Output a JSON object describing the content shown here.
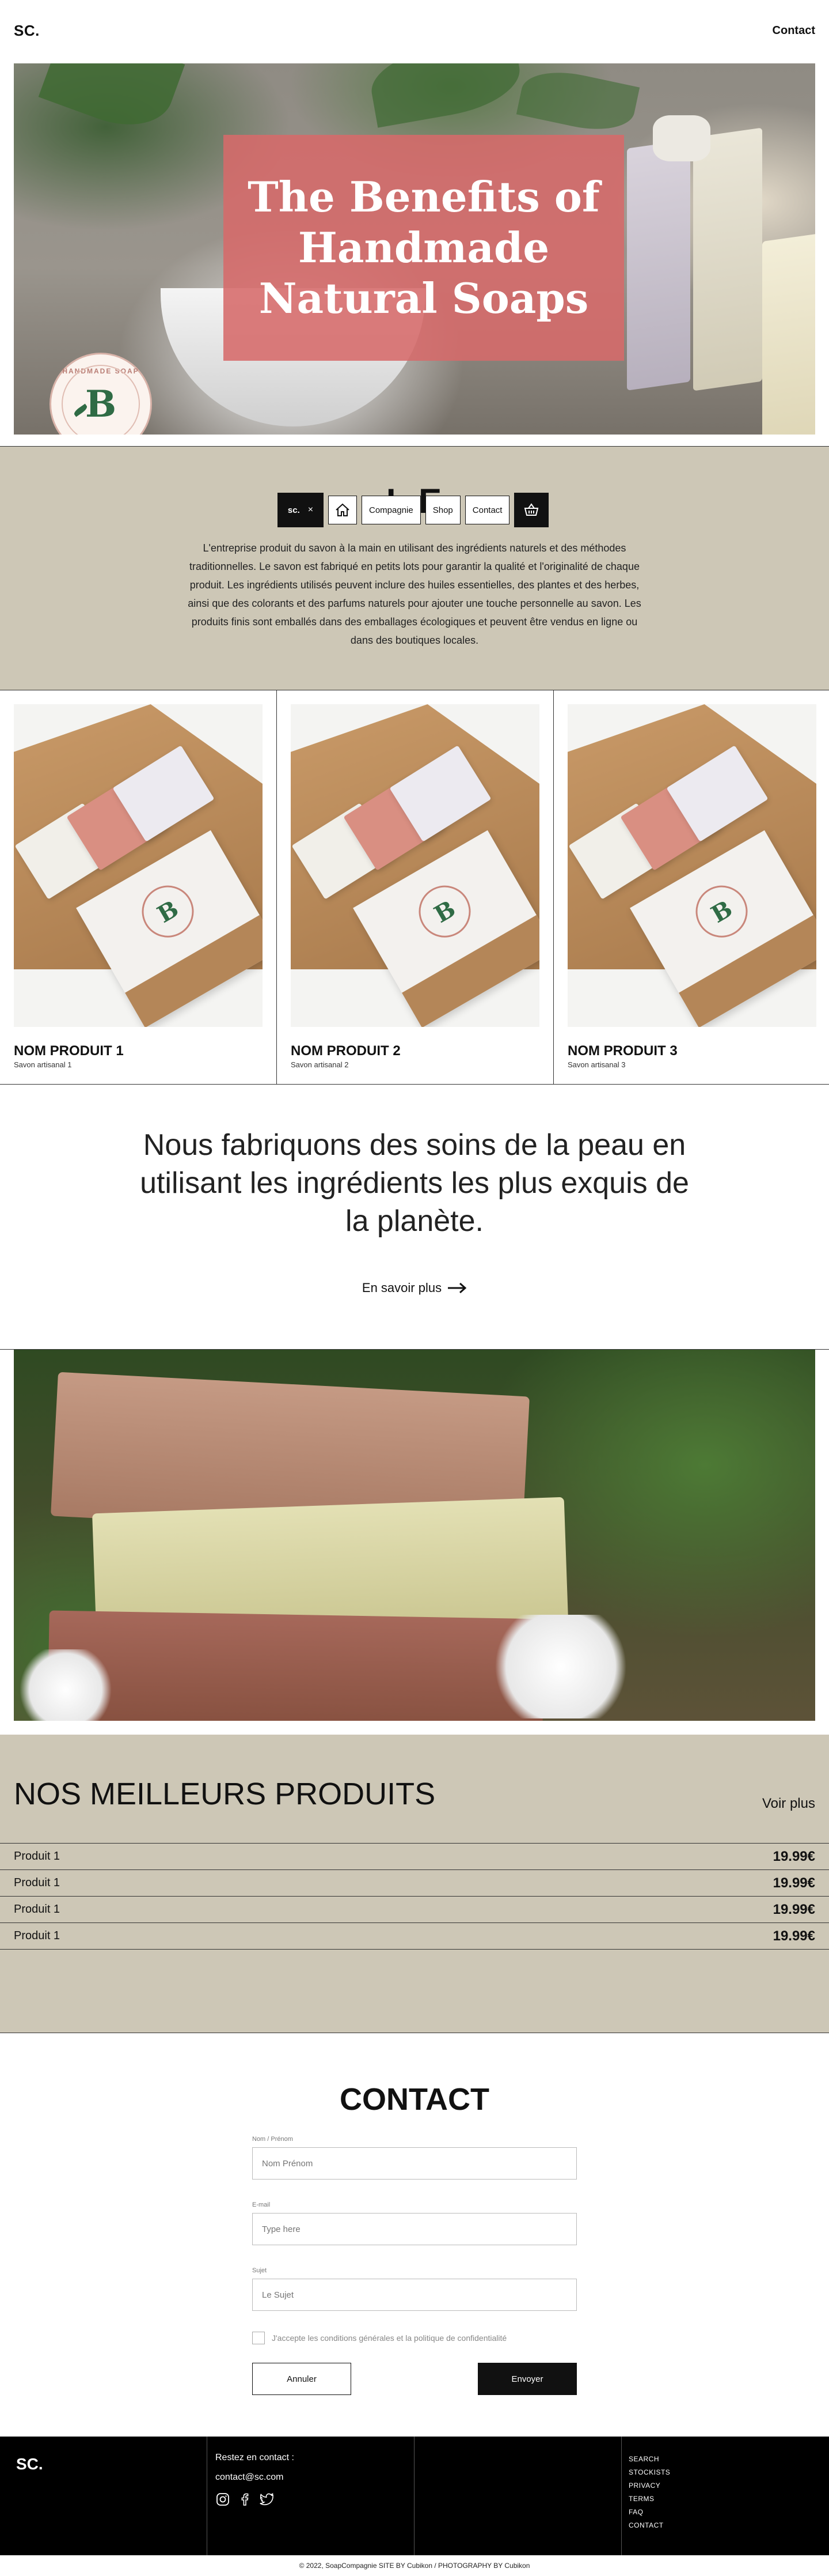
{
  "header": {
    "logo": "SC.",
    "contact": "Contact"
  },
  "hero": {
    "title": "The Benefits of Handmade Natural Soaps",
    "seal_letter": "B",
    "seal_text": "HANDMADE SOAP"
  },
  "about": {
    "heading": "L                          E",
    "text": "L'entreprise  produit du savon à la main en utilisant des ingrédients naturels et des méthodes traditionnelles. Le savon est fabriqué en petits lots pour garantir la qualité et l'originalité de chaque produit. Les ingrédients utilisés peuvent inclure des huiles essentielles, des plantes et des herbes, ainsi que des colorants et des parfums naturels pour ajouter une touche personnelle au savon. Les produits finis sont emballés dans des emballages écologiques et peuvent être vendus en ligne ou dans des boutiques locales."
  },
  "floating_nav": {
    "logo": "sc.",
    "close": "×",
    "items": [
      "Compagnie",
      "Shop",
      "Contact"
    ]
  },
  "products": [
    {
      "name": "NOM PRODUIT 1",
      "sub": "Savon artisanal 1"
    },
    {
      "name": "NOM PRODUIT 2",
      "sub": "Savon artisanal 2"
    },
    {
      "name": "NOM PRODUIT 3",
      "sub": "Savon artisanal 3"
    }
  ],
  "tagline": {
    "text": "Nous fabriquons des soins de la peau en utilisant les ingrédients les plus exquis de la planète.",
    "link": "En savoir plus"
  },
  "best": {
    "title": "NOS MEILLEURS PRODUITS",
    "more": "Voir plus",
    "items": [
      {
        "name": "Produit 1",
        "price": "19.99€"
      },
      {
        "name": "Produit 1",
        "price": "19.99€"
      },
      {
        "name": "Produit 1",
        "price": "19.99€"
      },
      {
        "name": "Produit 1",
        "price": "19.99€"
      }
    ]
  },
  "contact": {
    "title": "CONTACT",
    "name_label": "Nom / Prénom",
    "name_placeholder": "Nom Prénom",
    "email_label": "E-mail",
    "email_placeholder": "Type here",
    "subject_label": "Sujet",
    "subject_placeholder": "Le Sujet",
    "consent": "J'accepte les conditions générales et la politique de confidentialité",
    "cancel": "Annuler",
    "send": "Envoyer"
  },
  "footer": {
    "logo": "SC.",
    "stay": "Restez en contact :",
    "email": "contact@sc.com",
    "social_icons": [
      "instagram-icon",
      "facebook-icon",
      "twitter-icon"
    ],
    "links": [
      "SEARCH",
      "STOCKISTS",
      "PRIVACY",
      "TERMS",
      "FAQ",
      "CONTACT"
    ],
    "copyright": "© 2022, SoapCompagnie   SITE BY Cubikon  /  PHOTOGRAPHY BY Cubikon"
  }
}
